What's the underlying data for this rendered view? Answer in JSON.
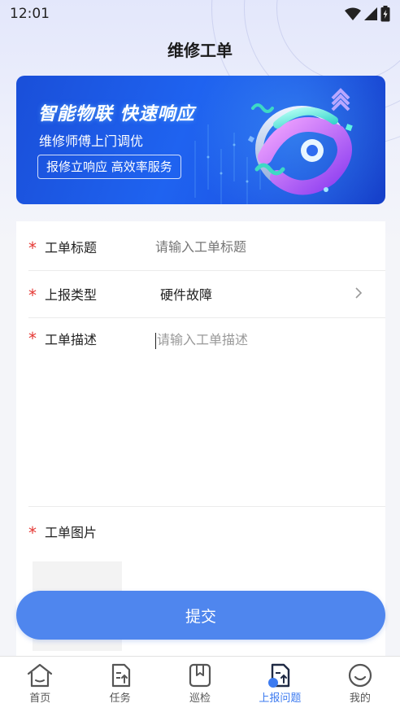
{
  "status_bar": {
    "time": "12:01"
  },
  "header": {
    "title": "维修工单"
  },
  "banner": {
    "headline": "智能物联  快速响应",
    "subtitle": "维修师傅上门调优",
    "pill": "报修立响应 高效率服务"
  },
  "form": {
    "title_field": {
      "label": "工单标题",
      "placeholder": "请输入工单标题",
      "value": ""
    },
    "type_field": {
      "label": "上报类型",
      "value": "硬件故障"
    },
    "desc_field": {
      "label": "工单描述",
      "placeholder": "请输入工单描述",
      "value": ""
    },
    "image_field": {
      "label": "工单图片"
    }
  },
  "submit_label": "提交",
  "tabbar": {
    "items": [
      {
        "label": "首页",
        "icon": "home-icon"
      },
      {
        "label": "任务",
        "icon": "task-icon"
      },
      {
        "label": "巡检",
        "icon": "patrol-icon"
      },
      {
        "label": "上报问题",
        "icon": "report-icon",
        "active": true
      },
      {
        "label": "我的",
        "icon": "profile-icon"
      }
    ]
  },
  "colors": {
    "accent": "#4f86ee",
    "active_tab": "#3d7bf0",
    "required": "#e53935",
    "banner": "#1f63f0"
  }
}
